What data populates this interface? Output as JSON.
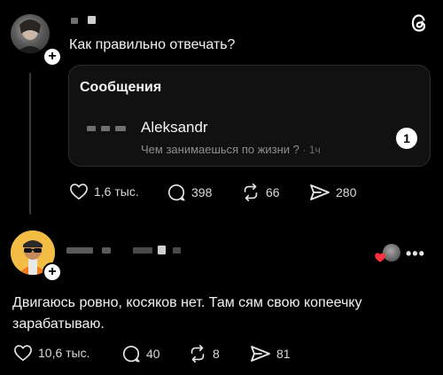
{
  "post1": {
    "question": "Как правильно отвечать?",
    "card": {
      "title": "Сообщения",
      "sender": "Aleksandr",
      "preview": "Чем занимаешься по жизни ?",
      "time": "· 1ч",
      "unread_count": "1"
    },
    "actions": {
      "likes": "1,6 тыс.",
      "comments": "398",
      "reposts": "66",
      "shares": "280"
    }
  },
  "post2": {
    "text_line1": "Двигаюсь ровно, косяков нет. Там сям свою копеечку",
    "text_line2": "зарабатываю.",
    "more_label": "•••",
    "actions": {
      "likes": "10,6 тыс.",
      "comments": "40",
      "reposts": "8",
      "shares": "81"
    }
  },
  "icons": {
    "app_logo": "threads-logo-icon",
    "like": "heart-icon",
    "comment": "speech-bubble-icon",
    "repost": "repost-arrows-icon",
    "share": "send-arrow-icon",
    "follow": "plus-icon",
    "liked_by": "heart-badge-icon"
  },
  "colors": {
    "background": "#000000",
    "text": "#f3f3f3",
    "muted": "#8e8e8e",
    "card_bg": "#111111",
    "liked_heart": "#ff3040"
  }
}
